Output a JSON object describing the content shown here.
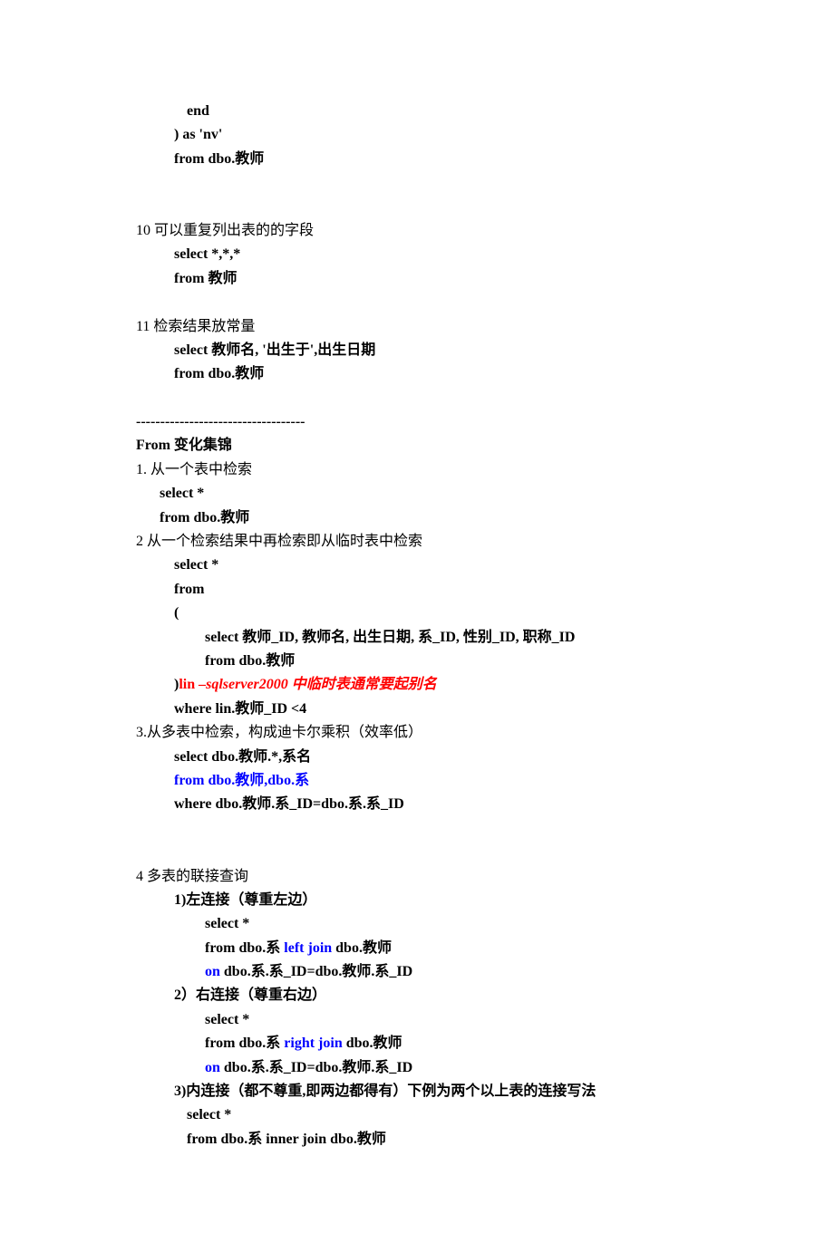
{
  "lines": {
    "l01": "end",
    "l02": ") as 'nv'",
    "l03": "from dbo.教师",
    "l04": "10  可以重复列出表的的字段",
    "l05": "select *,*,*",
    "l06": "from  教师",
    "l07": "11  检索结果放常量",
    "l08": "select  教师名, '出生于',出生日期",
    "l09": "from dbo.教师",
    "l10": "-----------------------------------",
    "l11": "From 变化集锦",
    "l12": "1.  从一个表中检索",
    "l13": "select *",
    "l14": "from dbo.教师",
    "l15": "2  从一个检索结果中再检索即从临时表中检索",
    "l16": "select *",
    "l17": "from",
    "l18": "(",
    "l19": "select  教师_ID,  教师名,  出生日期,  系_ID,  性别_ID,  职称_ID",
    "l20": "from dbo.教师",
    "l21a": ")",
    "l21b": "lin ",
    "l21c": "–sqlserver2000 中临时表通常要起别名",
    "l22": "where lin.教师_ID <4",
    "l23": "3.从多表中检索，构成迪卡尔乘积（效率低）",
    "l24": "select dbo.教师.*,系名",
    "l25": "from dbo.教师,dbo.系",
    "l26": "where dbo.教师.系_ID=dbo.系.系_ID",
    "l27": "4  多表的联接查询",
    "l28": "1)左连接（尊重左边）",
    "l29": "select *",
    "l30a": "from dbo.系  ",
    "l30b": "left join",
    "l30c": " dbo.教师",
    "l31a": "on",
    "l31b": " dbo.系.系_ID=dbo.教师.系_ID",
    "l32": "2）右连接（尊重右边）",
    "l33": "select *",
    "l34a": "from dbo.系  ",
    "l34b": "right join",
    "l34c": " dbo.教师",
    "l35a": "on",
    "l35b": " dbo.系.系_ID=dbo.教师.系_ID",
    "l36": "3)内连接（都不尊重,即两边都得有）下例为两个以上表的连接写法",
    "l37": "select *",
    "l38": "from dbo.系  inner join dbo.教师"
  }
}
